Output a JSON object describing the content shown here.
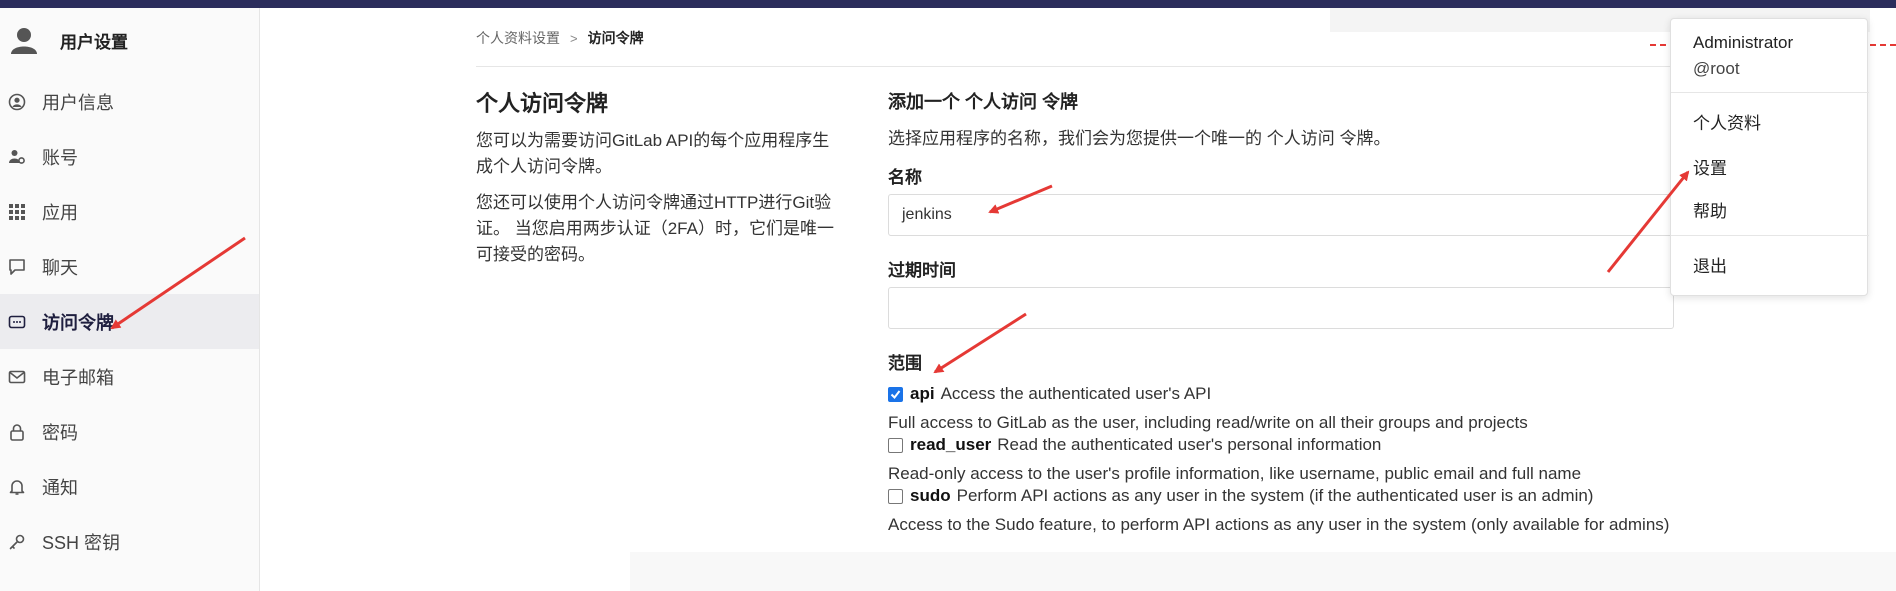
{
  "sidebar": {
    "title": "用户设置",
    "items": [
      {
        "label": "用户信息",
        "icon": "user-circle-icon"
      },
      {
        "label": "账号",
        "icon": "account-gear-icon"
      },
      {
        "label": "应用",
        "icon": "grid-icon"
      },
      {
        "label": "聊天",
        "icon": "chat-icon"
      },
      {
        "label": "访问令牌",
        "icon": "token-icon",
        "active": true
      },
      {
        "label": "电子邮箱",
        "icon": "mail-icon"
      },
      {
        "label": "密码",
        "icon": "lock-icon"
      },
      {
        "label": "通知",
        "icon": "bell-icon"
      },
      {
        "label": "SSH 密钥",
        "icon": "key-icon"
      }
    ]
  },
  "breadcrumb": {
    "parent": "个人资料设置",
    "separator": ">",
    "current": "访问令牌"
  },
  "main": {
    "title": "个人访问令牌",
    "desc1": "您可以为需要访问GitLab API的每个应用程序生成个人访问令牌。",
    "desc2": "您还可以使用个人访问令牌通过HTTP进行Git验证。 当您启用两步认证（2FA）时，它们是唯一可接受的密码。"
  },
  "form": {
    "heading": "添加一个 个人访问 令牌",
    "intro": "选择应用程序的名称，我们会为您提供一个唯一的 个人访问 令牌。",
    "name_label": "名称",
    "name_value": "jenkins",
    "expiry_label": "过期时间",
    "expiry_value": "",
    "scopes_label": "范围",
    "scopes": [
      {
        "name": "api",
        "summary": "Access the authenticated user's API",
        "detail": "Full access to GitLab as the user, including read/write on all their groups and projects",
        "checked": true
      },
      {
        "name": "read_user",
        "summary": "Read the authenticated user's personal information",
        "detail": "Read-only access to the user's profile information, like username, public email and full name",
        "checked": false
      },
      {
        "name": "sudo",
        "summary": "Perform API actions as any user in the system (if the authenticated user is an admin)",
        "detail": "Access to the Sudo feature, to perform API actions as any user in the system (only available for admins)",
        "checked": false
      }
    ]
  },
  "dropdown": {
    "name": "Administrator",
    "username": "@root",
    "items": [
      "个人资料",
      "设置",
      "帮助"
    ],
    "signout": "退出"
  },
  "colors": {
    "topbar": "#2b2d5c",
    "annotation_arrow": "#e53935",
    "checkbox_checked": "#1a73e8"
  }
}
